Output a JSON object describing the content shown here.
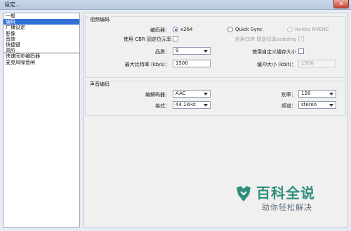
{
  "window": {
    "title": "设定...",
    "close": "✕"
  },
  "sidebar": {
    "items": [
      {
        "label": "一般",
        "selected": false
      },
      {
        "label": "编码",
        "selected": true
      },
      {
        "label": "广播设定",
        "selected": false
      },
      {
        "label": "影像",
        "selected": false
      },
      {
        "label": "音效",
        "selected": false
      },
      {
        "label": "快捷键",
        "selected": false
      },
      {
        "label": "高阶",
        "selected": false
      },
      {
        "label": "快速同步编码器",
        "selected": false
      },
      {
        "label": "麦克风噪音闸",
        "selected": false
      }
    ]
  },
  "video": {
    "section_title": "视频编码",
    "encoder_label": "编码器：",
    "x264": "x264",
    "quicksync": "Quick Sync",
    "nvenc": "Nvidia NVENC",
    "cbr_label": "使用 CBR 固定位元率",
    "cbr_padding_label": "启用CBR 固定码率padding",
    "quality_label": "品质：",
    "quality_value": "9",
    "custom_buffer_label": "使用自定义缓存大小",
    "max_bitrate_label": "最大比特率 (kb/s)：",
    "max_bitrate_value": "1500",
    "buffer_size_label": "缓冲大小 (kbit)：",
    "buffer_size_value": "1500"
  },
  "audio": {
    "section_title": "声音编码",
    "codec_label": "编解码器：",
    "codec_value": "AAC",
    "format_label": "格式：",
    "format_value": "44.1kHz",
    "bitrate_label": "别率：",
    "bitrate_value": "128",
    "channel_label": "频道：",
    "channel_value": "stereo"
  },
  "watermark": {
    "title": "百科全说",
    "subtitle": "助你轻松解决"
  },
  "colors": {
    "selection": "#2f6fd6",
    "brand": "#2f8f7b"
  }
}
